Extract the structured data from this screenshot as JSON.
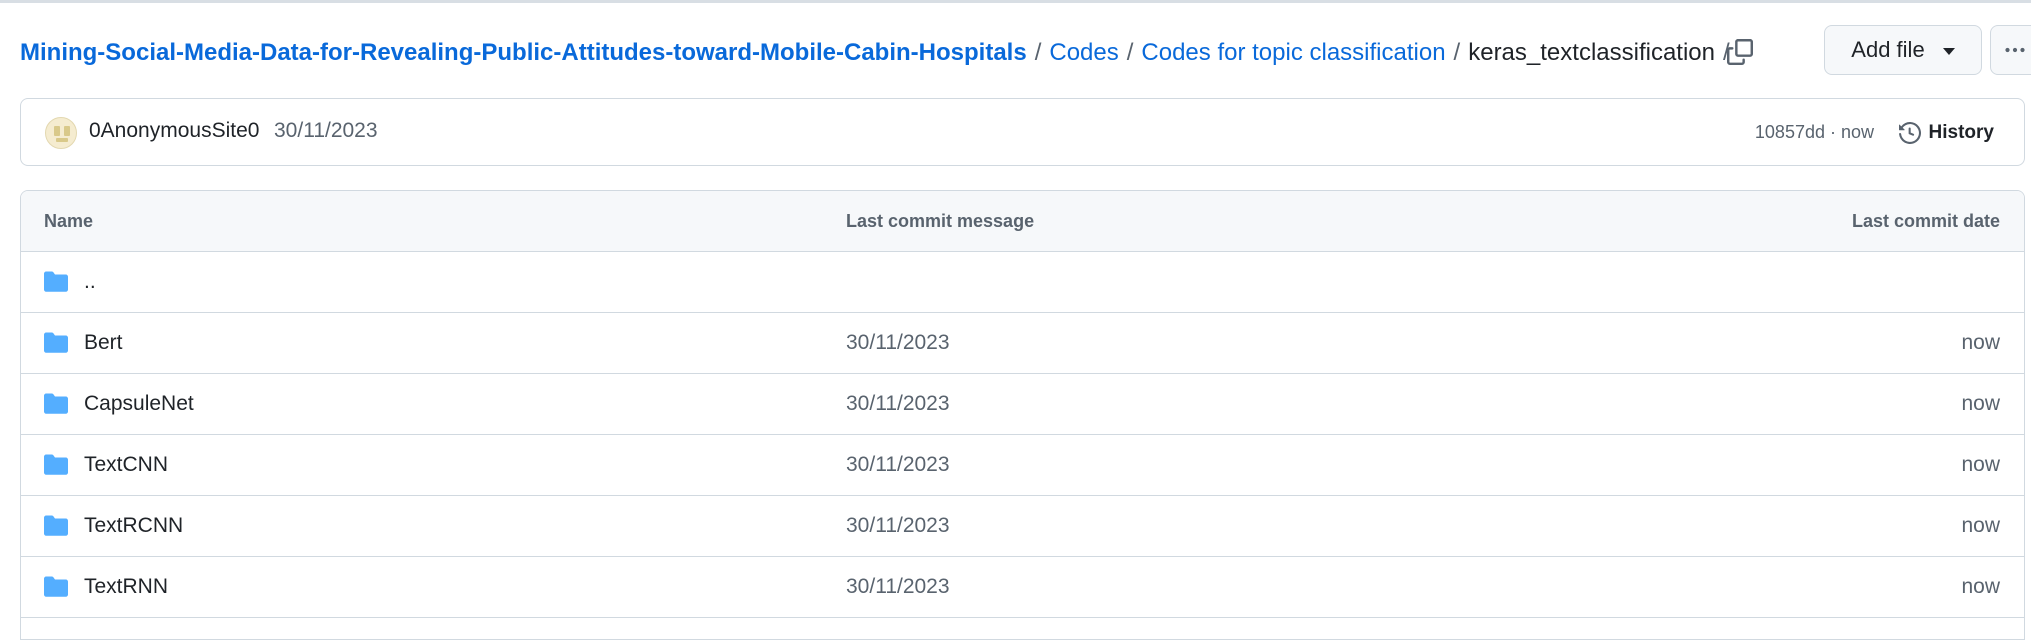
{
  "breadcrumb": {
    "repo": "Mining-Social-Media-Data-for-Revealing-Public-Attitudes-toward-Mobile-Cabin-Hospitals",
    "separator": "/",
    "path": [
      "Codes",
      "Codes for topic classification"
    ],
    "current": "keras_textclassification"
  },
  "actions": {
    "add_file_label": "Add file",
    "more_icon": "kebab-horizontal-icon",
    "copy_icon": "copy-icon"
  },
  "commit": {
    "author": "0AnonymousSite0",
    "date": "30/11/2023",
    "sha_time": "10857dd · now",
    "history_label": "History"
  },
  "table": {
    "headers": {
      "name": "Name",
      "message": "Last commit message",
      "date": "Last commit date"
    },
    "rows": [
      {
        "name": "..",
        "message": "",
        "date": ""
      },
      {
        "name": "Bert",
        "message": "30/11/2023",
        "date": "now"
      },
      {
        "name": "CapsuleNet",
        "message": "30/11/2023",
        "date": "now"
      },
      {
        "name": "TextCNN",
        "message": "30/11/2023",
        "date": "now"
      },
      {
        "name": "TextRCNN",
        "message": "30/11/2023",
        "date": "now"
      },
      {
        "name": "TextRNN",
        "message": "30/11/2023",
        "date": "now"
      }
    ]
  },
  "colors": {
    "link": "#0969da",
    "folder": "#54aeff",
    "border": "#d1d9e0",
    "muted": "#59636e"
  }
}
